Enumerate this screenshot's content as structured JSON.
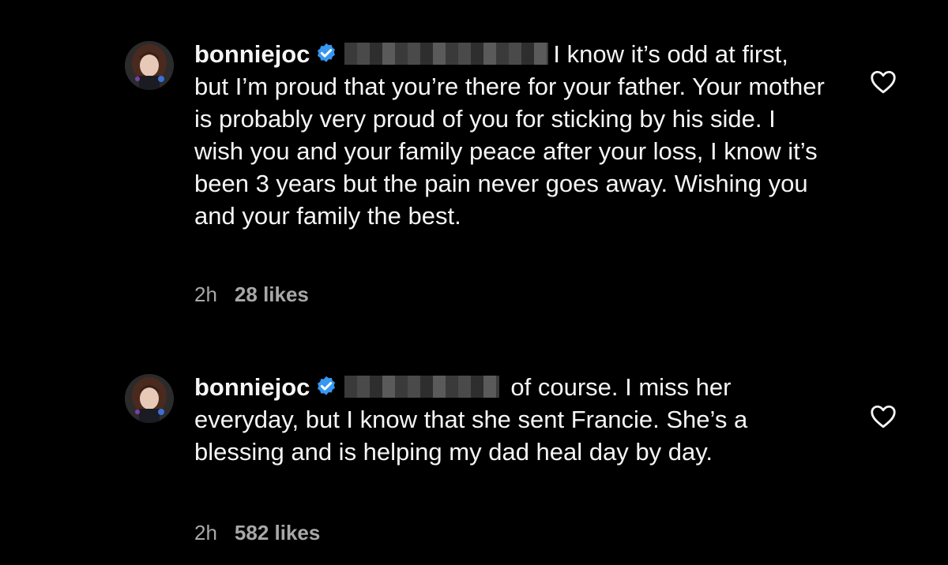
{
  "colors": {
    "background": "#000000",
    "text": "#f5f5f5",
    "meta_text": "#a8a8a8",
    "verified_badge": "#3897f0"
  },
  "comments": [
    {
      "username": "bonniejoc",
      "verified_icon": "verified-badge-icon",
      "mention_redacted": true,
      "text": "I know it’s odd at first, but I’m proud that you’re there for your father. Your mother is probably very proud of you for sticking by his side. I wish you and your family peace after your loss, I know it’s been 3 years but the pain never goes away. Wishing you and your family the best.",
      "time": "2h",
      "likes": "28 likes",
      "like_icon": "heart-outline-icon"
    },
    {
      "username": "bonniejoc",
      "verified_icon": "verified-badge-icon",
      "mention_redacted": true,
      "text": "of course. I miss her everyday, but I know that she sent Francie. She’s a blessing and is helping my dad heal day by day.",
      "time": "2h",
      "likes": "582 likes",
      "like_icon": "heart-outline-icon"
    }
  ]
}
